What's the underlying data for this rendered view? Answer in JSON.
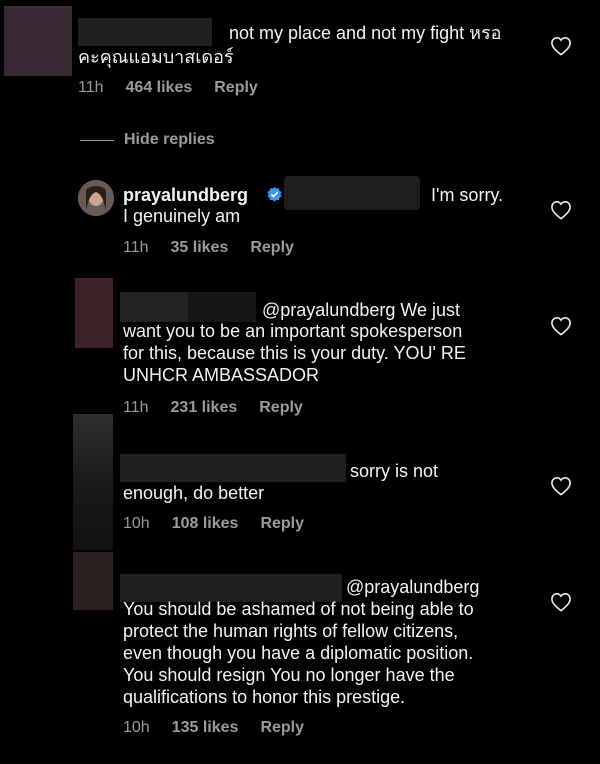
{
  "comments": [
    {
      "line1": "not my place and not my fight หรอ",
      "line2": "คะคุณแอมบาสเดอร์",
      "time": "11h",
      "likes": "464 likes",
      "reply": "Reply",
      "avatar_color": "#3a2a33"
    }
  ],
  "hide_replies": "Hide replies",
  "replies": [
    {
      "username": "prayalundberg",
      "line1_end": "I'm sorry.",
      "line2": "I genuinely am",
      "time": "11h",
      "likes": "35 likes",
      "reply": "Reply"
    },
    {
      "line1": "@prayalundberg We just",
      "line2": "want you to be an important spokesperson",
      "line3": "for this, because this is your duty. YOU' RE",
      "line4": "UNHCR AMBASSADOR",
      "time": "11h",
      "likes": "231 likes",
      "reply": "Reply",
      "avatar_color": "#3d2228"
    },
    {
      "line1": "sorry is not",
      "line2": "enough, do better",
      "time": "10h",
      "likes": "108 likes",
      "reply": "Reply",
      "avatar_color": "#2b2b2b"
    },
    {
      "line1": "@prayalundberg",
      "line2": "You should be ashamed of not being able to",
      "line3": "protect the human rights of fellow citizens,",
      "line4": "even though you have a diplomatic position.",
      "line5": "You should resign  You no longer have the",
      "line6": "qualifications to honor this prestige.",
      "time": "10h",
      "likes": "135 likes",
      "reply": "Reply",
      "avatar_color": "#2a2020"
    }
  ],
  "colors": {
    "background": "#000000",
    "meta": "#9a9a9a",
    "verified": "#3897f0"
  },
  "icons": {
    "like": "heart-outline-icon",
    "verified": "verified-badge-icon"
  }
}
